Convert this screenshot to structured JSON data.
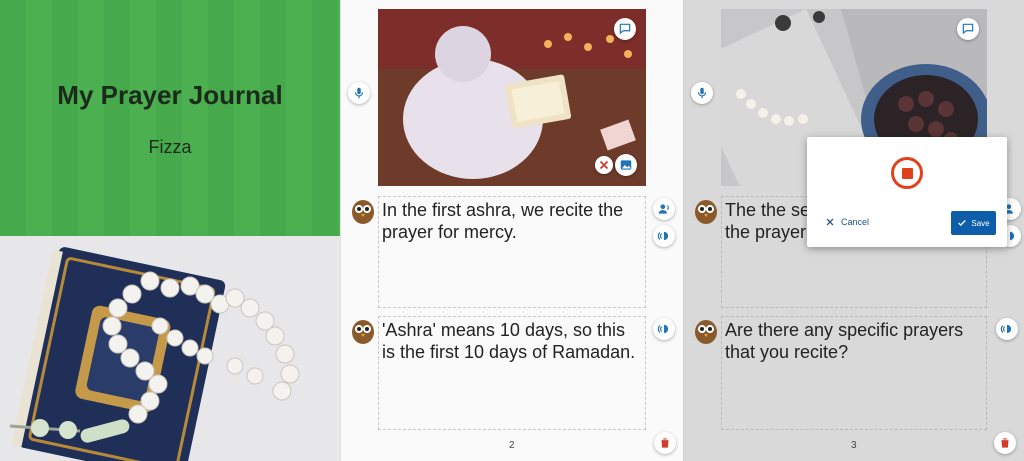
{
  "cover": {
    "title": "My Prayer Journal",
    "author": "Fizza"
  },
  "page2": {
    "page_number": "2",
    "text_blocks": [
      "In the first ashra, we recite the prayer for mercy.",
      "'Ashra' means 10 days, so this is the first 10 days of Ramadan."
    ]
  },
  "page3": {
    "page_number": "3",
    "text_blocks": [
      "The the second ashra, we recite the prayer for forgiveness.",
      "Are there any specific prayers that you recite?"
    ]
  },
  "record_dialog": {
    "cancel_label": "Cancel",
    "save_label": "Save"
  },
  "colors": {
    "cover_green": "#4caf50",
    "accent_blue": "#1f73b7",
    "record_red": "#e0401b",
    "save_blue": "#0d5dab"
  },
  "icons": [
    "microphone-icon",
    "speech-bubble-icon",
    "image-icon",
    "remove-icon",
    "voice-person-icon",
    "speaker-icon",
    "trash-icon",
    "owl-icon",
    "stop-record-icon",
    "check-icon",
    "close-icon"
  ]
}
